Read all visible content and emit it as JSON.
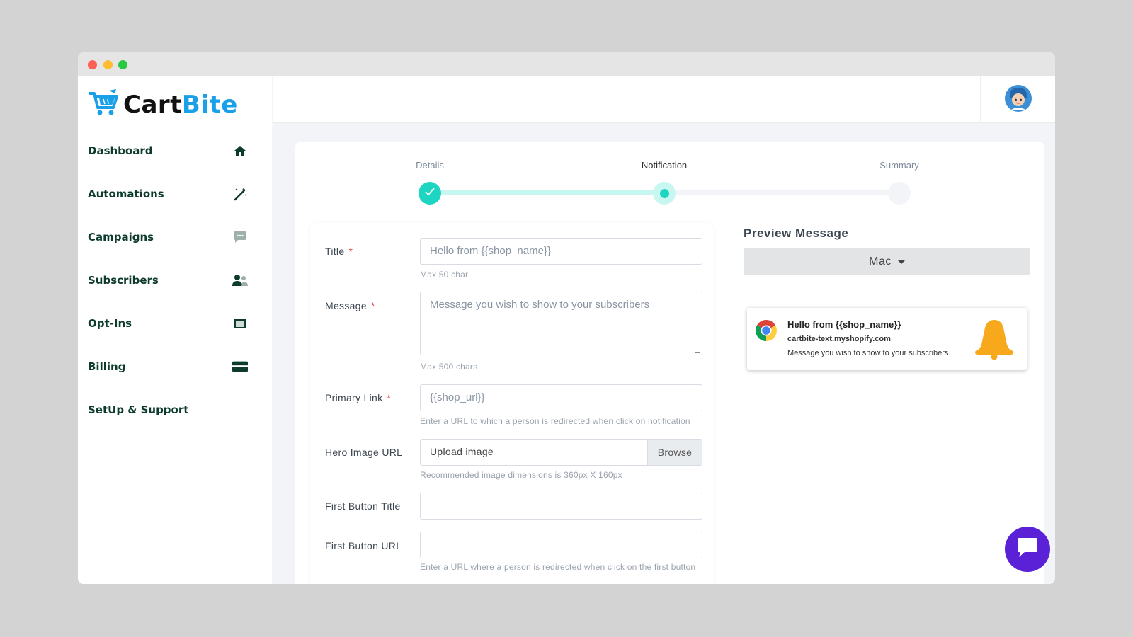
{
  "app": {
    "logo": {
      "part1": "Cart",
      "part2": "Bite"
    }
  },
  "sidebar": {
    "items": [
      {
        "label": "Dashboard",
        "icon": "home-icon"
      },
      {
        "label": "Automations",
        "icon": "magic-wand-icon"
      },
      {
        "label": "Campaigns",
        "icon": "message-icon"
      },
      {
        "label": "Subscribers",
        "icon": "users-icon"
      },
      {
        "label": "Opt-Ins",
        "icon": "window-icon"
      },
      {
        "label": "Billing",
        "icon": "credit-card-icon"
      },
      {
        "label": "SetUp & Support",
        "icon": ""
      }
    ]
  },
  "stepper": {
    "steps": [
      {
        "label": "Details",
        "state": "completed"
      },
      {
        "label": "Notification",
        "state": "active"
      },
      {
        "label": "Summary",
        "state": "upcoming"
      }
    ]
  },
  "form": {
    "title": {
      "label": "Title",
      "required_mark": "*",
      "placeholder": "Hello from {{shop_name}}",
      "hint": "Max 50 char"
    },
    "message": {
      "label": "Message",
      "required_mark": "*",
      "placeholder": "Message you wish to show to your subscribers",
      "hint": "Max 500 chars"
    },
    "primary_link": {
      "label": "Primary Link",
      "required_mark": "*",
      "placeholder": "{{shop_url}}",
      "hint": "Enter a URL to which a person is redirected when click on notification"
    },
    "hero_image": {
      "label": "Hero Image URL",
      "placeholder": "Upload image",
      "button": "Browse",
      "hint": "Recommended image dimensions is 360px X 160px"
    },
    "first_button_title": {
      "label": "First Button Title",
      "value": ""
    },
    "first_button_url": {
      "label": "First Button URL",
      "value": "",
      "hint": "Enter a URL where a person is redirected when click on the first button"
    }
  },
  "preview": {
    "title": "Preview Message",
    "os_selected": "Mac",
    "notification": {
      "title": "Hello from {{shop_name}}",
      "site": "cartbite-text.myshopify.com",
      "message": "Message you wish to show to your subscribers",
      "browser_icon": "chrome-icon",
      "image_icon": "bell-icon"
    }
  },
  "colors": {
    "accent": "#1aa0e8",
    "step": "#1dd5c0",
    "step_light": "#c8f6f1",
    "nav_text": "#0d3b2e",
    "chat": "#5b21d6",
    "bell": "#f7a81b"
  },
  "chat_widget": {
    "icon": "chat-icon"
  }
}
